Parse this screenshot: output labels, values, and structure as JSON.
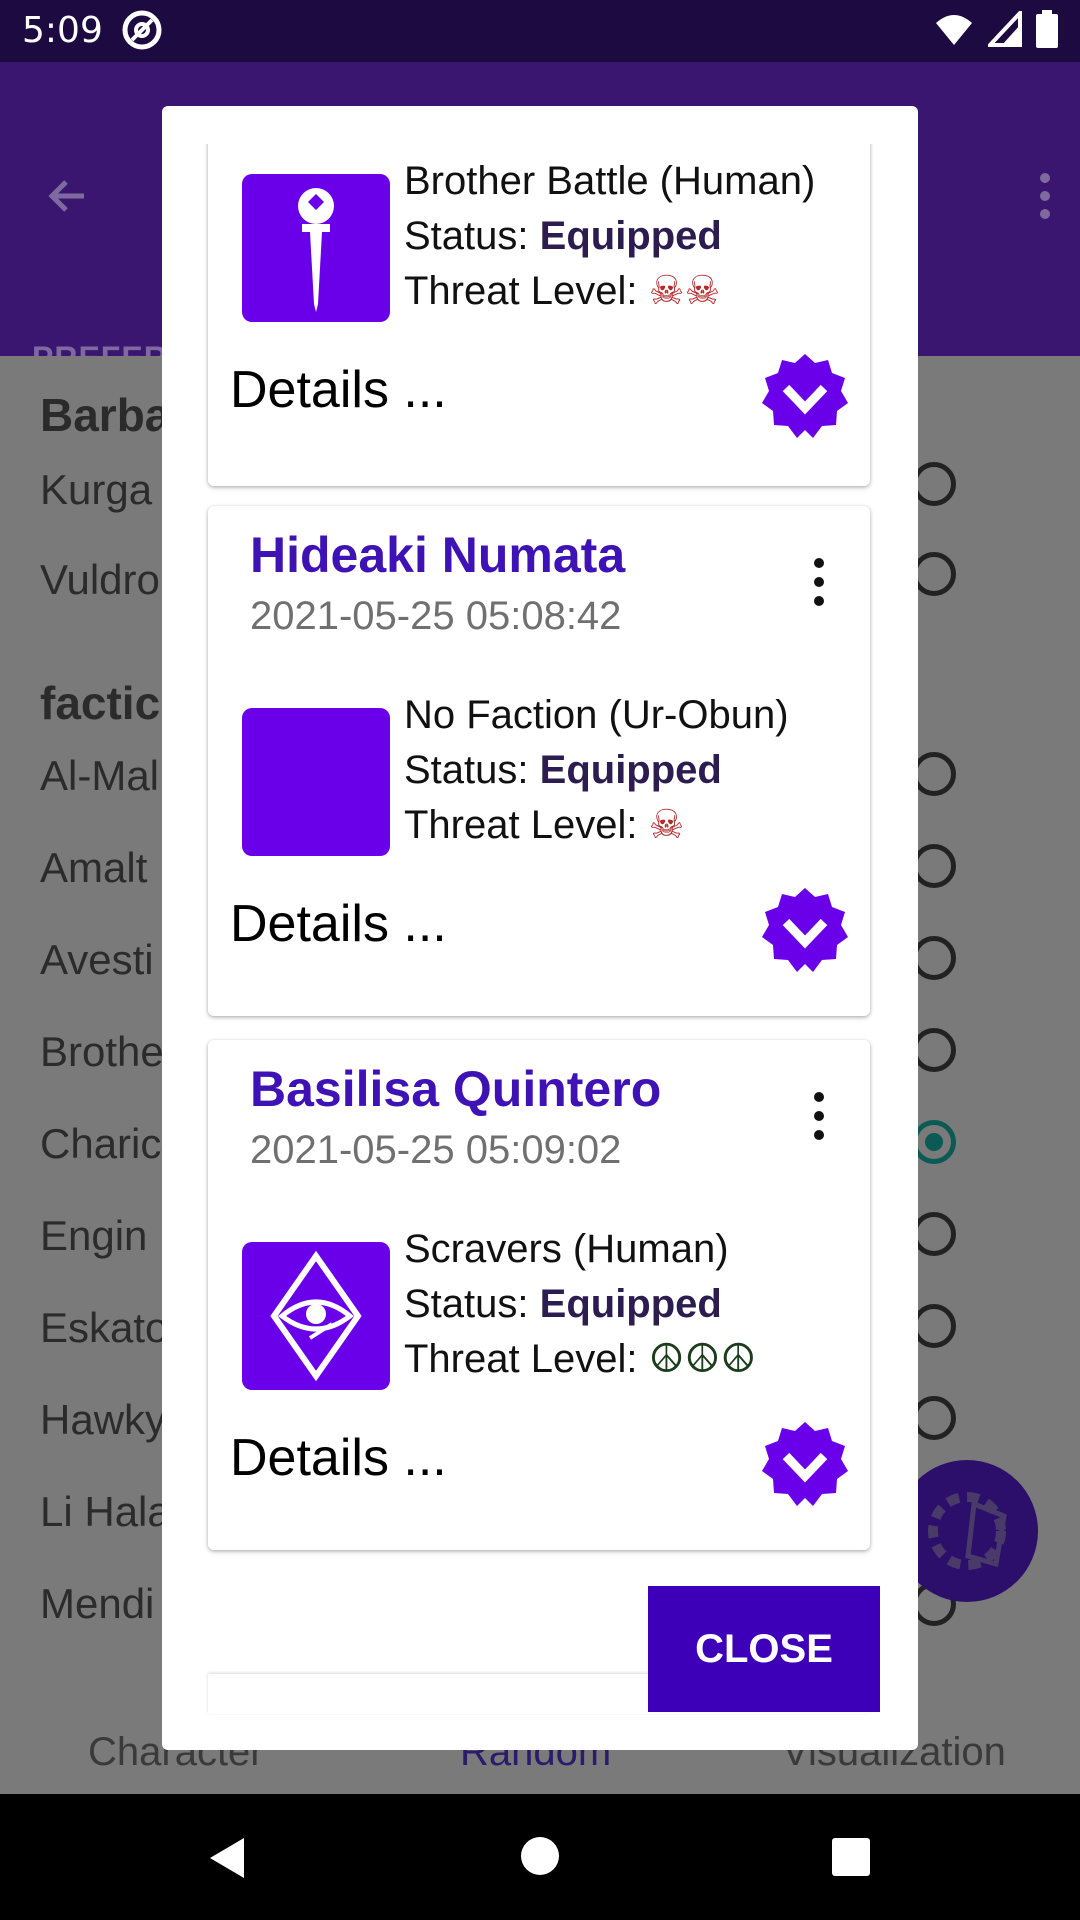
{
  "status_bar": {
    "time": "5:09"
  },
  "background": {
    "tab_partial": "PREFER",
    "rows": [
      {
        "label": "Barba",
        "heading": true
      },
      {
        "label": "Kurga"
      },
      {
        "label": "Vuldro"
      },
      {
        "label": "factic",
        "heading": true
      },
      {
        "label": "Al-Mal"
      },
      {
        "label": "Amalt"
      },
      {
        "label": "Avesti"
      },
      {
        "label": "Brothe"
      },
      {
        "label": "Charic",
        "selected": true
      },
      {
        "label": "Engin"
      },
      {
        "label": "Eskato"
      },
      {
        "label": "Hawky"
      },
      {
        "label": "Li Hala"
      },
      {
        "label": "Mendi"
      }
    ],
    "bottom_nav": {
      "character": "Character",
      "random": "Random",
      "visualization": "Visualization"
    }
  },
  "dialog": {
    "cards": [
      {
        "faction": "Brother Battle (Human)",
        "status_label": "Status:",
        "status_value": "Equipped",
        "threat_label": "Threat Level:",
        "threat": "☠☠",
        "details": "Details ..."
      },
      {
        "name": "Hideaki Numata",
        "date": "2021-05-25 05:08:42",
        "faction": "No Faction (Ur-Obun)",
        "status_label": "Status:",
        "status_value": "Equipped",
        "threat_label": "Threat Level:",
        "threat": "☠",
        "details": "Details ..."
      },
      {
        "name": "Basilisa Quintero",
        "date": "2021-05-25 05:09:02",
        "faction": "Scravers (Human)",
        "status_label": "Status:",
        "status_value": "Equipped",
        "threat_label": "Threat Level:",
        "threat": "☮☮☮",
        "details": "Details ..."
      }
    ],
    "close_label": "CLOSE"
  },
  "colors": {
    "accent": "#6a00ea",
    "name": "#3f12b5",
    "button": "#3d00b8",
    "appbar": "#3b1670"
  }
}
